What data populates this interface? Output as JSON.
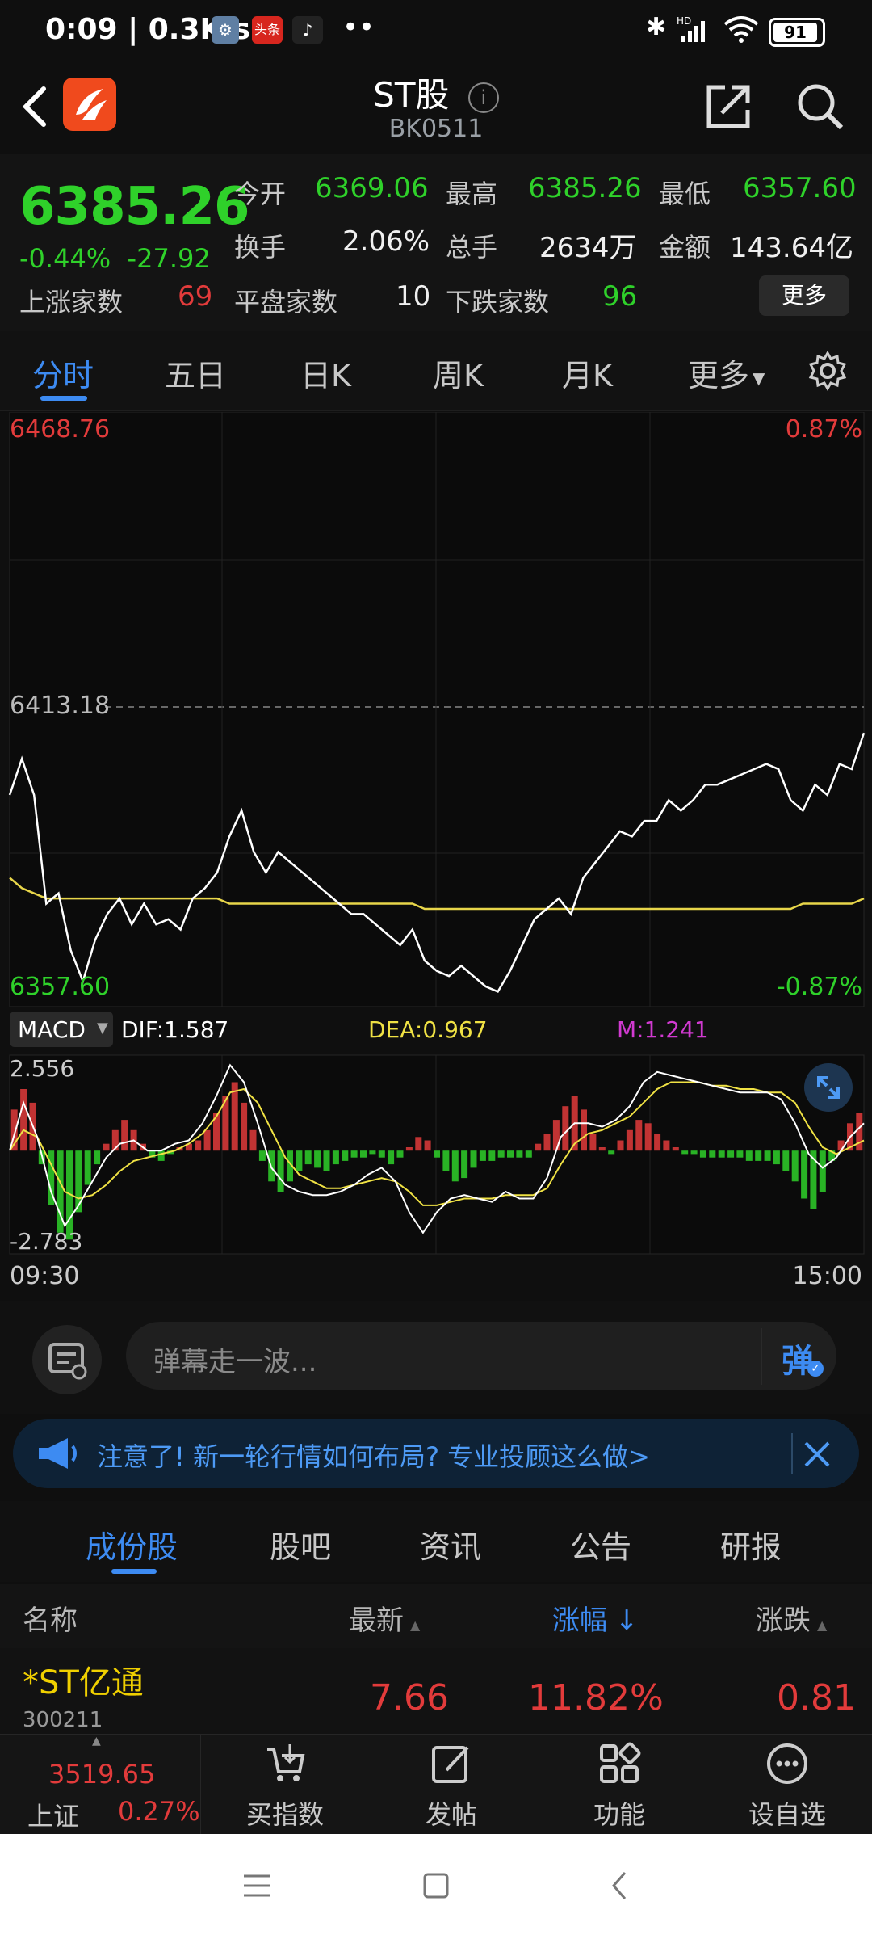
{
  "status_bar": {
    "time_speed": "0:09 | 0.3K/s",
    "battery": "91",
    "icons": [
      "settings-app-icon",
      "toutiao-app-icon",
      "tiktok-app-icon",
      "more-dots-icon",
      "bluetooth-icon",
      "hd-signal-icon",
      "wifi-icon",
      "battery-icon"
    ]
  },
  "header": {
    "title": "ST股",
    "code": "BK0511",
    "icons": [
      "back-arrow-icon",
      "app-logo-icon",
      "info-icon",
      "share-icon",
      "search-icon"
    ]
  },
  "quote": {
    "price": "6385.26",
    "change_pct": "-0.44%",
    "change_abs": "-27.92",
    "open_label": "今开",
    "open": "6369.06",
    "high_label": "最高",
    "high": "6385.26",
    "low_label": "最低",
    "low": "6357.60",
    "turnover_label": "换手",
    "turnover": "2.06%",
    "volume_label": "总手",
    "volume": "2634万",
    "amount_label": "金额",
    "amount": "143.64亿",
    "up_label": "上涨家数",
    "up": "69",
    "flat_label": "平盘家数",
    "flat": "10",
    "down_label": "下跌家数",
    "down": "96",
    "more_label": "更多"
  },
  "tabs": [
    "分时",
    "五日",
    "日K",
    "周K",
    "月K",
    "更多"
  ],
  "chart_data": {
    "type": "line",
    "y_axis": {
      "top": "6468.76",
      "mid": "6413.18",
      "bottom": "6357.60"
    },
    "pct_axis": {
      "top": "0.87%",
      "bottom": "-0.87%"
    },
    "x_axis": {
      "start": "09:30",
      "end": "15:00"
    },
    "price_series": [
      6396,
      6403,
      6396,
      6375,
      6377,
      6366,
      6360,
      6368,
      6373,
      6376,
      6371,
      6375,
      6371,
      6372,
      6370,
      6376,
      6378,
      6381,
      6388,
      6393,
      6385,
      6381,
      6385,
      6383,
      6381,
      6379,
      6377,
      6375,
      6373,
      6373,
      6371,
      6369,
      6367,
      6370,
      6364,
      6362,
      6361,
      6363,
      6361,
      6359,
      6358,
      6362,
      6367,
      6372,
      6374,
      6376,
      6373,
      6380,
      6383,
      6386,
      6389,
      6388,
      6391,
      6391,
      6395,
      6393,
      6395,
      6398,
      6398,
      6399,
      6400,
      6401,
      6402,
      6401,
      6395,
      6393,
      6398,
      6396,
      6402,
      6401,
      6408
    ],
    "avg_series": [
      6380,
      6378,
      6377,
      6376,
      6376,
      6376,
      6376,
      6376,
      6376,
      6376,
      6376,
      6376,
      6376,
      6376,
      6376,
      6376,
      6376,
      6376,
      6375,
      6375,
      6375,
      6375,
      6375,
      6375,
      6375,
      6375,
      6375,
      6375,
      6375,
      6375,
      6375,
      6375,
      6375,
      6375,
      6374,
      6374,
      6374,
      6374,
      6374,
      6374,
      6374,
      6374,
      6374,
      6374,
      6374,
      6374,
      6374,
      6374,
      6374,
      6374,
      6374,
      6374,
      6374,
      6374,
      6374,
      6374,
      6374,
      6374,
      6374,
      6374,
      6374,
      6374,
      6374,
      6374,
      6374,
      6375,
      6375,
      6375,
      6375,
      6375,
      6376
    ],
    "macd": {
      "label": "MACD",
      "dif_label": "DIF:1.587",
      "dea_label": "DEA:0.967",
      "m_label": "M:1.241",
      "top": "2.556",
      "bottom": "-2.783",
      "histogram": [
        1.2,
        1.8,
        1.4,
        -0.4,
        -1.6,
        -2.4,
        -2.6,
        -1.8,
        -1.0,
        -0.4,
        0.2,
        0.6,
        0.9,
        0.6,
        0.2,
        -0.2,
        -0.3,
        -0.1,
        0.1,
        0.2,
        0.3,
        0.6,
        1.1,
        1.6,
        2.0,
        1.4,
        0.6,
        -0.3,
        -0.9,
        -1.2,
        -0.9,
        -0.6,
        -0.4,
        -0.5,
        -0.6,
        -0.4,
        -0.3,
        -0.2,
        -0.2,
        -0.1,
        -0.2,
        -0.4,
        -0.2,
        0.1,
        0.4,
        0.3,
        -0.2,
        -0.6,
        -0.9,
        -0.8,
        -0.5,
        -0.3,
        -0.3,
        -0.2,
        -0.2,
        -0.2,
        -0.2,
        0.2,
        0.5,
        0.9,
        1.3,
        1.6,
        1.2,
        0.5,
        0.1,
        -0.1,
        0.3,
        0.6,
        0.9,
        0.8,
        0.5,
        0.3,
        0.1,
        -0.1,
        -0.1,
        -0.2,
        -0.2,
        -0.2,
        -0.2,
        -0.2,
        -0.3,
        -0.3,
        -0.3,
        -0.4,
        -0.6,
        -0.9,
        -1.4,
        -1.7,
        -1.2,
        -0.3,
        0.3,
        0.8,
        1.1
      ],
      "dif": [
        0.0,
        1.4,
        0.4,
        -1.2,
        -2.2,
        -1.6,
        -0.9,
        -0.2,
        0.2,
        0.3,
        0.0,
        0.0,
        0.2,
        0.3,
        0.8,
        1.6,
        2.5,
        2.0,
        0.8,
        -0.5,
        -1.0,
        -1.2,
        -1.3,
        -1.3,
        -1.2,
        -1.0,
        -0.7,
        -0.5,
        -0.9,
        -1.8,
        -2.4,
        -1.8,
        -1.4,
        -1.3,
        -1.4,
        -1.5,
        -1.2,
        -1.4,
        -1.4,
        -0.8,
        0.4,
        0.8,
        0.8,
        0.7,
        0.9,
        1.3,
        2.0,
        2.3,
        2.2,
        2.1,
        2.0,
        1.9,
        1.8,
        1.7,
        1.7,
        1.7,
        1.5,
        0.8,
        -0.1,
        -0.5,
        -0.2,
        0.4,
        0.8
      ],
      "dea": [
        0.0,
        0.6,
        0.4,
        -0.4,
        -1.2,
        -1.4,
        -1.3,
        -1.0,
        -0.6,
        -0.3,
        -0.2,
        -0.1,
        0.0,
        0.2,
        0.5,
        1.0,
        1.7,
        1.8,
        1.4,
        0.6,
        -0.2,
        -0.7,
        -0.9,
        -1.1,
        -1.1,
        -1.0,
        -0.9,
        -0.8,
        -0.9,
        -1.2,
        -1.6,
        -1.6,
        -1.5,
        -1.4,
        -1.4,
        -1.4,
        -1.3,
        -1.3,
        -1.3,
        -1.1,
        -0.4,
        0.2,
        0.5,
        0.6,
        0.8,
        1.0,
        1.4,
        1.8,
        2.0,
        2.0,
        2.0,
        1.9,
        1.9,
        1.8,
        1.8,
        1.7,
        1.7,
        1.4,
        0.7,
        0.1,
        -0.1,
        0.1,
        0.3
      ]
    }
  },
  "colors": {
    "up": "#e23b3b",
    "down": "#2fd12a",
    "accent": "#3d8bf2",
    "avg_line": "#e8d64a",
    "dea": "#f0e244",
    "m": "#d13ad1"
  },
  "danmu": {
    "placeholder": "弹幕走一波...",
    "send_label": "弹"
  },
  "notice": {
    "text": "注意了! 新一轮行情如何布局? 专业投顾这么做>"
  },
  "sub_tabs": [
    "成份股",
    "股吧",
    "资讯",
    "公告",
    "研报"
  ],
  "table": {
    "headers": {
      "name": "名称",
      "latest": "最新",
      "change_pct": "涨幅",
      "change": "涨跌"
    },
    "rows": [
      {
        "name": "*ST亿通",
        "code": "300211",
        "latest": "7.66",
        "change_pct": "11.82%",
        "change": "0.81"
      }
    ]
  },
  "bottom_bar": {
    "index_value": "3519.65",
    "index_name": "上证",
    "index_change": "0.27%",
    "items": [
      "买指数",
      "发帖",
      "功能",
      "设自选"
    ]
  }
}
